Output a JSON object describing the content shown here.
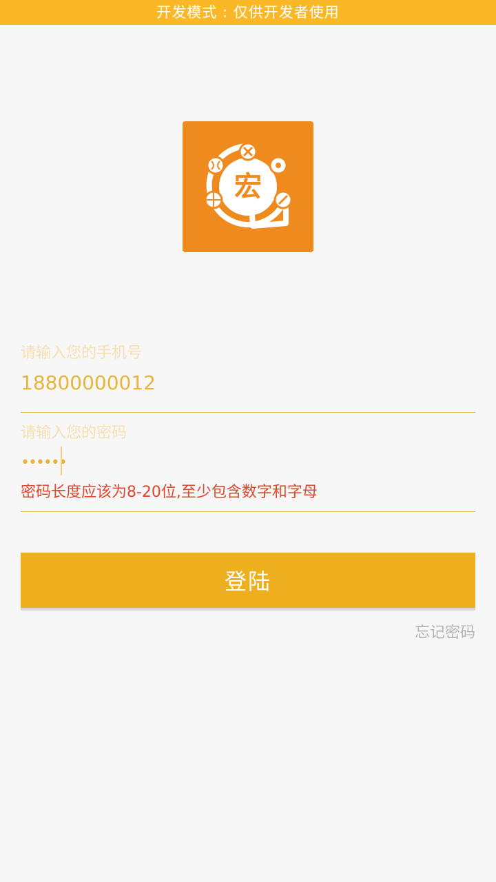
{
  "banner": {
    "text": "开发模式 : 仅供开发者使用"
  },
  "logo": {
    "character": "宏",
    "background_color": "#ef8a1e"
  },
  "form": {
    "phone": {
      "placeholder": "请输入您的手机号",
      "value": "18800000012"
    },
    "password": {
      "placeholder": "请输入您的密码",
      "masked_value": "••••••",
      "error": "密码长度应该为8-20位,至少包含数字和字母"
    },
    "login_label": "登陆",
    "forgot_label": "忘记密码"
  },
  "colors": {
    "accent": "#eeaf1f",
    "banner": "#fbb826",
    "error": "#e0462e",
    "input_text": "#e8b43a"
  }
}
